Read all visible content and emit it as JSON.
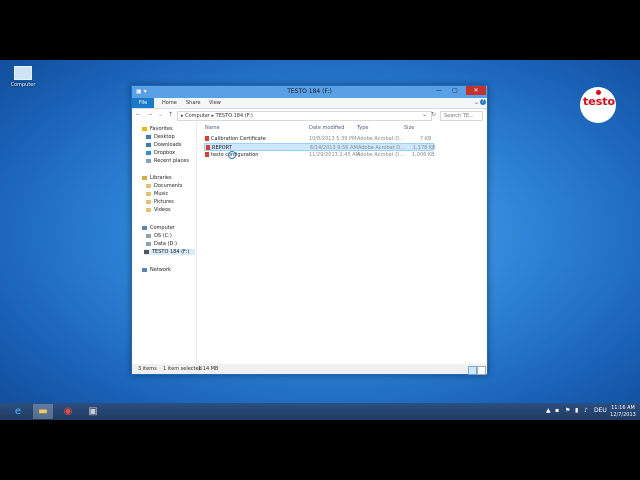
{
  "desktop": {
    "computer_label": "Computer"
  },
  "logo": {
    "text": "testo"
  },
  "window": {
    "title": "TESTO 184 (F:)",
    "close": "✕",
    "ribbon": {
      "file": "File",
      "home": "Home",
      "share": "Share",
      "view": "View"
    },
    "address": "▸ Computer ▸ TESTO 184 (F:)",
    "search_placeholder": "Search TE..."
  },
  "nav": {
    "favorites": "Favorites",
    "desktop": "Desktop",
    "downloads": "Downloads",
    "dropbox": "Dropbox",
    "recent": "Recent places",
    "libraries": "Libraries",
    "documents": "Documents",
    "music": "Music",
    "pictures": "Pictures",
    "videos": "Videos",
    "computer": "Computer",
    "os": "OS (C:)",
    "data": "Data (D:)",
    "testo": "TESTO 184 (F:)",
    "network": "Network"
  },
  "columns": {
    "name": "Name",
    "date": "Date modified",
    "type": "Type",
    "size": "Size"
  },
  "files": [
    {
      "name": "Calibration Certificate",
      "date": "10/8/2013 5:39 PM",
      "type": "Adobe Acrobat D...",
      "size": "7 KB"
    },
    {
      "name": "REPORT",
      "date": "6/14/2013 9:56 AM",
      "type": "Adobe Acrobat D...",
      "size": "1,178 KB"
    },
    {
      "name": "testo configuration",
      "date": "11/29/2013 2:45 AM",
      "type": "Adobe Acrobat D...",
      "size": "1,006 KB"
    }
  ],
  "status": {
    "count": "3 items",
    "selected": "1 item selected",
    "size": "1.14 MB"
  },
  "taskbar": {
    "lang": "DEU",
    "time": "11:16 AM",
    "date": "12/7/2013"
  }
}
